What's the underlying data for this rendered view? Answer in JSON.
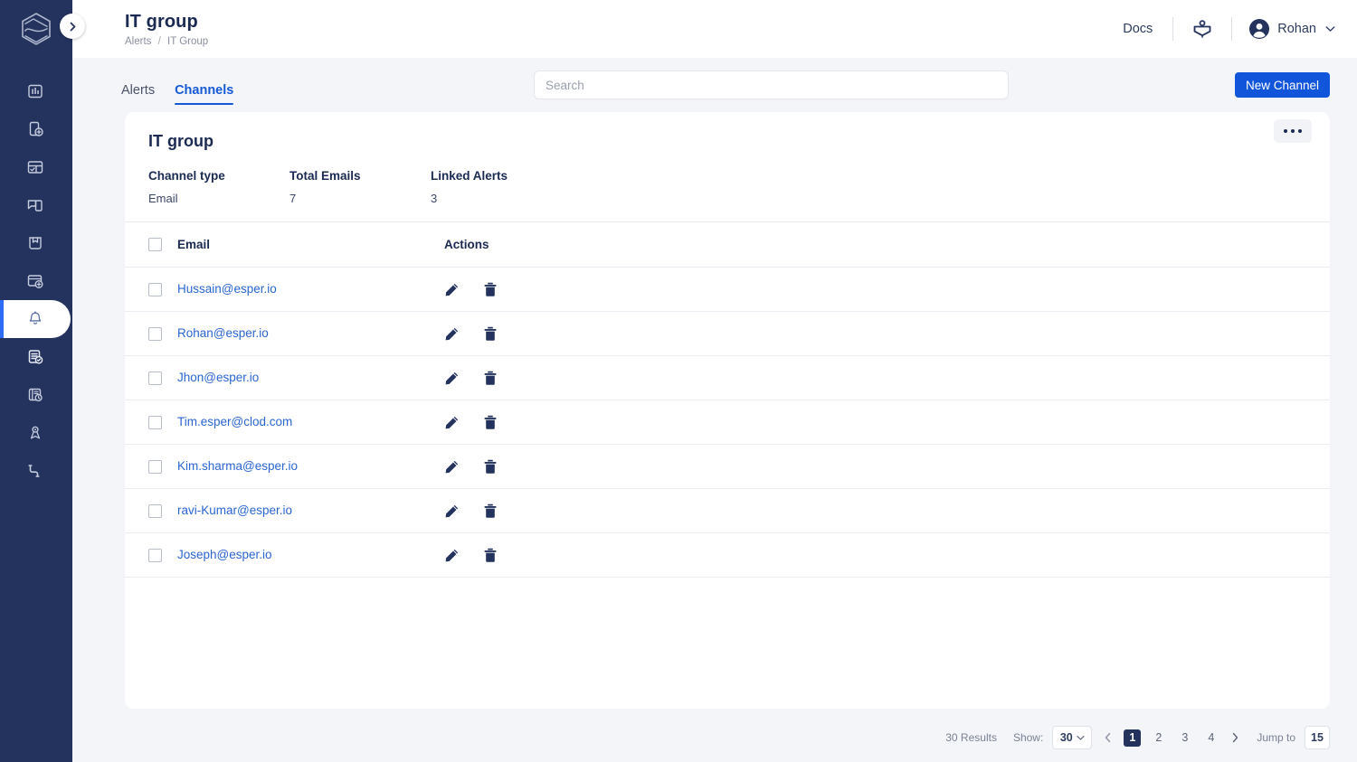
{
  "sidebar": {
    "logo_name": "esper-hexagon-logo",
    "collapse_label": "›",
    "items": [
      {
        "icon": "dashboard-chart-icon",
        "name": "dashboard",
        "active": false
      },
      {
        "icon": "device-add-icon",
        "name": "devices",
        "active": false
      },
      {
        "icon": "app-management-icon",
        "name": "apps",
        "active": false
      },
      {
        "icon": "content-icon",
        "name": "content",
        "active": false
      },
      {
        "icon": "blueprint-icon",
        "name": "blueprints",
        "active": false
      },
      {
        "icon": "group-add-icon",
        "name": "groups",
        "active": false
      },
      {
        "icon": "bell-icon",
        "name": "alerts",
        "active": true
      },
      {
        "icon": "report-check-icon",
        "name": "reports",
        "active": false
      },
      {
        "icon": "compliance-icon",
        "name": "compliance",
        "active": false
      },
      {
        "icon": "pipeline-icon",
        "name": "pipelines",
        "active": false
      },
      {
        "icon": "integration-icon",
        "name": "integrations",
        "active": false
      }
    ]
  },
  "header": {
    "title": "IT group",
    "breadcrumb_parent": "Alerts",
    "breadcrumb_sep": "/",
    "breadcrumb_current": "IT Group",
    "docs_label": "Docs",
    "learn_icon": "academy-book-icon",
    "user_name": "Rohan",
    "user_avatar_icon": "avatar-icon",
    "chevron_icon": "chevron-down-icon"
  },
  "toolbar": {
    "tabs": [
      {
        "label": "Alerts",
        "active": false
      },
      {
        "label": "Channels",
        "active": true
      }
    ],
    "search_placeholder": "Search",
    "search_value": "",
    "new_channel_label": "New Channel"
  },
  "card": {
    "title": "IT group",
    "kebab_icon": "more-options-icon",
    "meta": [
      {
        "label": "Channel type",
        "value": "Email"
      },
      {
        "label": "Total Emails",
        "value": "7"
      },
      {
        "label": "Linked Alerts",
        "value": "3"
      }
    ],
    "table": {
      "columns": [
        "Email",
        "Actions"
      ],
      "rows": [
        {
          "email": "Hussain@esper.io"
        },
        {
          "email": "Rohan@esper.io"
        },
        {
          "email": "Jhon@esper.io"
        },
        {
          "email": "Tim.esper@clod.com"
        },
        {
          "email": "Kim.sharma@esper.io"
        },
        {
          "email": "ravi-Kumar@esper.io"
        },
        {
          "email": "Joseph@esper.io"
        }
      ],
      "row_actions": [
        {
          "icon": "edit-pencil-icon",
          "name": "edit"
        },
        {
          "icon": "delete-trash-icon",
          "name": "delete"
        }
      ]
    }
  },
  "pagination": {
    "results_label": "30 Results",
    "show_label": "Show:",
    "page_size": "30",
    "prev_icon": "chevron-left-icon",
    "next_icon": "chevron-right-icon",
    "pages": [
      "1",
      "2",
      "3",
      "4"
    ],
    "current_page": "1",
    "jump_label": "Jump to",
    "jump_value": "15"
  },
  "colors": {
    "sidebar_bg": "#23335e",
    "accent_blue": "#1155db",
    "link_blue": "#2a66d0",
    "page_bg": "#f4f5f9",
    "title_navy": "#1b2a52"
  }
}
